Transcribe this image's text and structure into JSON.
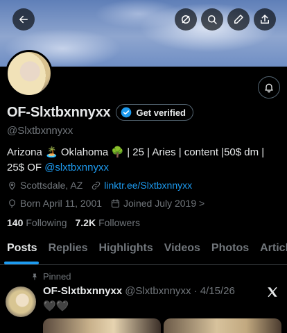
{
  "profile": {
    "display_name": "OF-Slxtbxnnyxx",
    "verify_label": "Get verified",
    "handle": "@Slxtbxnnyxx",
    "bio_text": "Arizona 🏝️ Oklahoma 🌳 | 25 | Aries | content |50$ dm | 25$ OF ",
    "bio_mention": "@slxtbxnnyxx",
    "location": "Scottsdale, AZ",
    "link": "linktr.ee/Slxtbxnnyxx",
    "born": "Born April 11, 2001",
    "joined": "Joined July 2019 >",
    "following_count": "140",
    "following_label": "Following",
    "followers_count": "7.2K",
    "followers_label": "Followers"
  },
  "tabs": [
    "Posts",
    "Replies",
    "Highlights",
    "Videos",
    "Photos",
    "Articles"
  ],
  "pinned_post": {
    "pinned_label": "Pinned",
    "author": "OF-Slxtbxnnyxx",
    "meta": "@Slxtbxnnyxx · 4/15/26",
    "text": "🖤🖤"
  },
  "icons": {
    "back": "back-arrow-icon",
    "incognito": "mute-icon",
    "search": "search-icon",
    "edit": "pencil-icon",
    "share": "share-icon",
    "bell": "notification-bell-icon"
  },
  "colors": {
    "accent": "#1d9bf0",
    "muted": "#71767b",
    "text": "#e7e9ea",
    "bg": "#000000"
  }
}
